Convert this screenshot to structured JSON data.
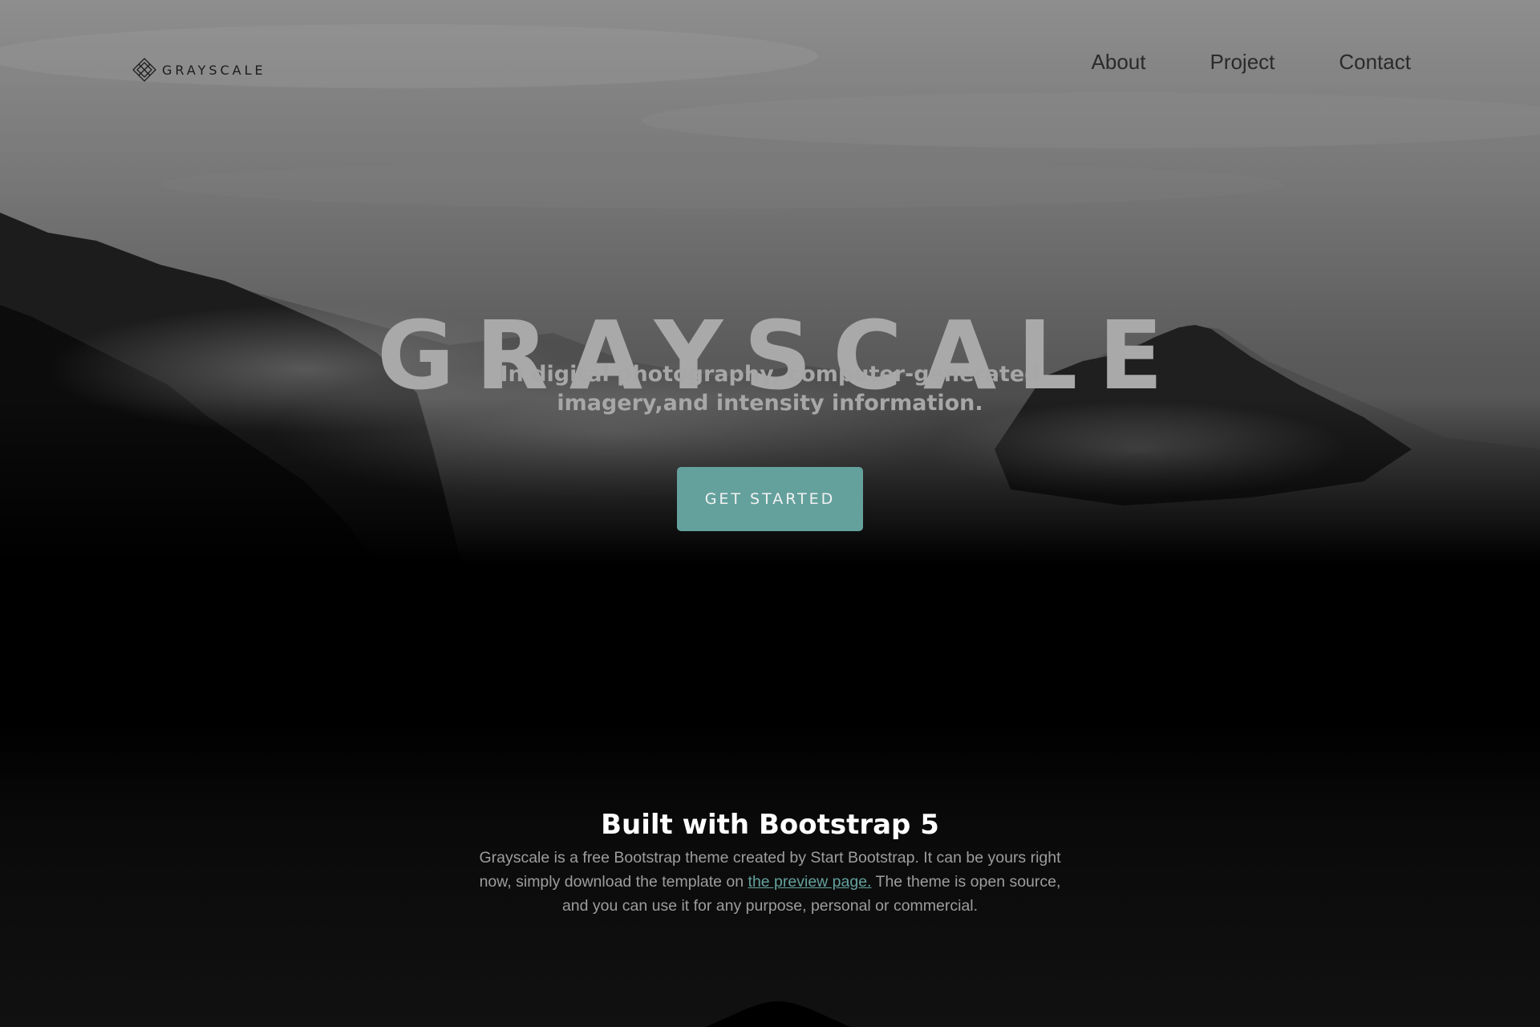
{
  "navbar": {
    "brand": "GRAYSCALE",
    "links": [
      "About",
      "Project",
      "Contact"
    ]
  },
  "hero": {
    "title": "GRAYSCALE",
    "subtitle": "In digital photography, computer-generated imagery,and intensity information.",
    "cta_label": "GET STARTED"
  },
  "about": {
    "title": "Built with Bootstrap 5",
    "text_before": "Grayscale is a free Bootstrap theme created by Start Bootstrap. It can be yours right now, simply download the template on ",
    "link_text": "the preview page.",
    "text_after": " The theme is open source, and you can use it for any purpose, personal or commercial."
  },
  "colors": {
    "accent": "#64a19d",
    "hero_text": "#a9a9a9",
    "nav_text": "#2a2a2a",
    "background": "#000000"
  },
  "icons": {
    "brand": "diamond-logo-icon"
  }
}
